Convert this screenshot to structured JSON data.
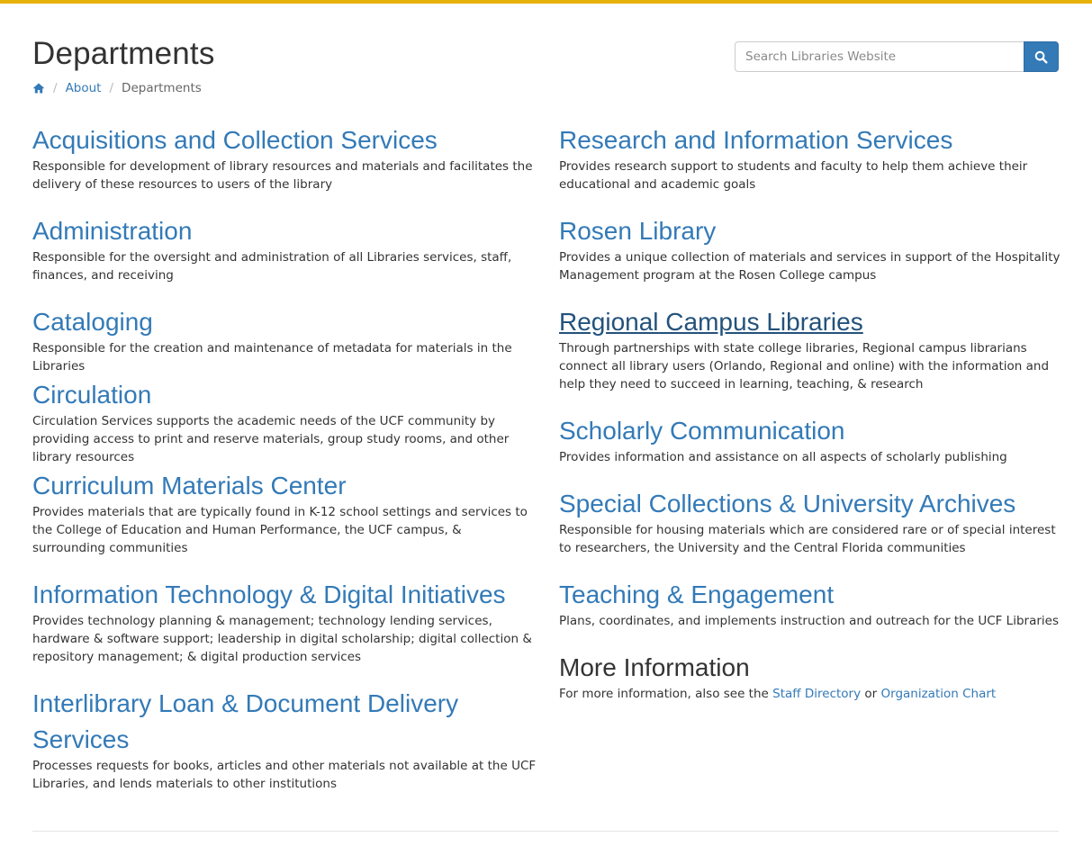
{
  "header": {
    "title": "Departments",
    "search_placeholder": "Search Libraries Website"
  },
  "breadcrumb": {
    "home_icon": "home-icon",
    "items": [
      "About",
      "Departments"
    ]
  },
  "left_departments": [
    {
      "name": "Acquisitions and Collection Services",
      "desc": "Responsible for development of library resources and materials and facilitates the delivery of these resources to users of the library"
    },
    {
      "name": "Administration",
      "desc": "Responsible for the oversight and administration of all Libraries services, staff, finances, and receiving"
    },
    {
      "name": "Cataloging",
      "desc": "Responsible for the creation and maintenance of metadata for materials in the Libraries"
    },
    {
      "name": "Circulation",
      "desc": "Circulation Services supports the academic needs of the UCF community by providing access to print and reserve materials, group study rooms, and other library resources"
    },
    {
      "name": "Curriculum Materials Center",
      "desc": "Provides materials that are typically found in K-12 school settings and services to the College of Education and Human Performance, the UCF campus, & surrounding communities"
    },
    {
      "name": "Information Technology & Digital Initiatives",
      "desc": "Provides technology planning & management; technology lending services, hardware & software support; leadership in digital scholarship; digital collection & repository management; & digital production services"
    },
    {
      "name": "Interlibrary Loan & Document Delivery Services",
      "desc": "Processes requests for books, articles and other materials not available at the UCF Libraries, and lends materials to other institutions"
    }
  ],
  "right_departments": [
    {
      "name": "Research and Information Services",
      "desc": "Provides research support to students and faculty to help them achieve their educational and academic goals"
    },
    {
      "name": "Rosen Library",
      "desc": "Provides a unique collection of materials and services in support of the Hospitality Management program at the Rosen College campus"
    },
    {
      "name": "Regional Campus Libraries",
      "desc": "Through partnerships with state college libraries, Regional campus librarians connect all library users (Orlando, Regional and online) with the information and help they need to succeed in learning, teaching, & research"
    },
    {
      "name": "Scholarly Communication",
      "desc": "Provides information and assistance on all aspects of scholarly publishing"
    },
    {
      "name": "Special Collections & University Archives",
      "desc": "Responsible for housing materials which are considered rare or of special interest to researchers, the University and the Central Florida communities"
    },
    {
      "name": "Teaching & Engagement",
      "desc": "Plans, coordinates, and implements instruction and outreach for the UCF Libraries"
    }
  ],
  "more_info": {
    "heading": "More Information",
    "text_before": "For more information, also see the",
    "link1": "Staff Directory",
    "text_between": "or",
    "link2": "Organization Chart"
  },
  "colors": {
    "accent_bar": "#e6b10a",
    "link": "#337ab7",
    "link_hover": "#23527c"
  }
}
